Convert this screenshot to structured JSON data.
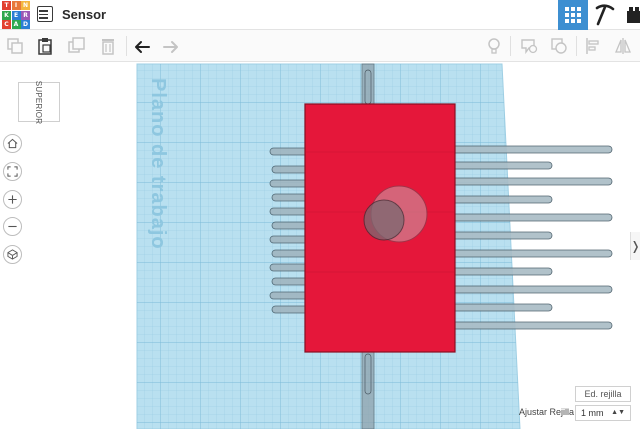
{
  "app": {
    "logo_letters": [
      "T",
      "I",
      "N",
      "K",
      "E",
      "R",
      "C",
      "A",
      "D"
    ],
    "logo_colors": [
      "#e2402f",
      "#e8773a",
      "#f4b740",
      "#2fa84f",
      "#2a7fd4",
      "#9b59b6",
      "#e2402f",
      "#2fa84f",
      "#2a7fd4"
    ]
  },
  "header": {
    "title": "Sensor"
  },
  "workplane": {
    "label": "Plano de trabajo",
    "color": "#9fd3ea",
    "grid_color": "#7fbddb"
  },
  "view_cube": {
    "face_label": "SUPERIOR"
  },
  "grid_controls": {
    "edit_grid_label": "Ed. rejilla",
    "snap_label": "Ajustar Rejilla",
    "snap_value": "1 mm"
  },
  "colors": {
    "accent": "#3d8fd1",
    "board": "#e5173a",
    "pin": "#8aa6b4"
  }
}
